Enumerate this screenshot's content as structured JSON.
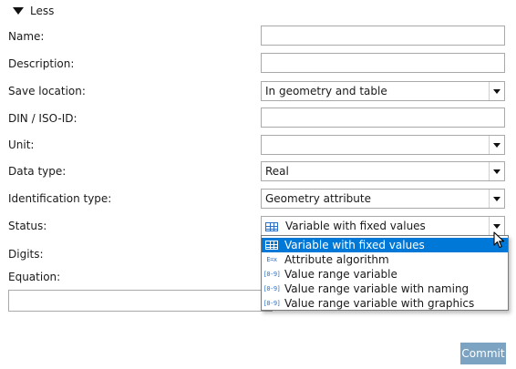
{
  "toggle": {
    "label": "Less",
    "icon": "triangle-down-icon"
  },
  "fields": {
    "name": {
      "label": "Name:",
      "value": ""
    },
    "description": {
      "label": "Description:",
      "value": ""
    },
    "save_location": {
      "label": "Save location:",
      "value": "In geometry and table"
    },
    "din": {
      "label": "DIN / ISO-ID:",
      "value": ""
    },
    "unit": {
      "label": "Unit:",
      "value": ""
    },
    "data_type": {
      "label": "Data type:",
      "value": "Real"
    },
    "identification_type": {
      "label": "Identification type:",
      "value": "Geometry attribute"
    },
    "status": {
      "label": "Status:",
      "value": "Variable with fixed values",
      "icon": "table-grid-icon"
    },
    "digits": {
      "label": "Digits:"
    },
    "equation": {
      "label": "Equation:",
      "value": ""
    }
  },
  "status_options": [
    {
      "label": "Variable with fixed values",
      "icon": "table-grid-icon",
      "icon_text": "",
      "selected": true
    },
    {
      "label": "Attribute algorithm",
      "icon": "algorithm-icon",
      "icon_text": "E=x",
      "selected": false
    },
    {
      "label": "Value range variable",
      "icon": "range-icon",
      "icon_text": "[0-9]",
      "selected": false
    },
    {
      "label": "Value range variable with naming",
      "icon": "range-naming-icon",
      "icon_text": "[0-9]",
      "selected": false
    },
    {
      "label": "Value range variable with graphics",
      "icon": "range-graphics-icon",
      "icon_text": "[0-9]",
      "selected": false
    }
  ],
  "commit": {
    "label": "Commit"
  },
  "colors": {
    "selection": "#0078d7",
    "commit_bg": "#7ca3c2",
    "icon": "#2a6fc9"
  }
}
